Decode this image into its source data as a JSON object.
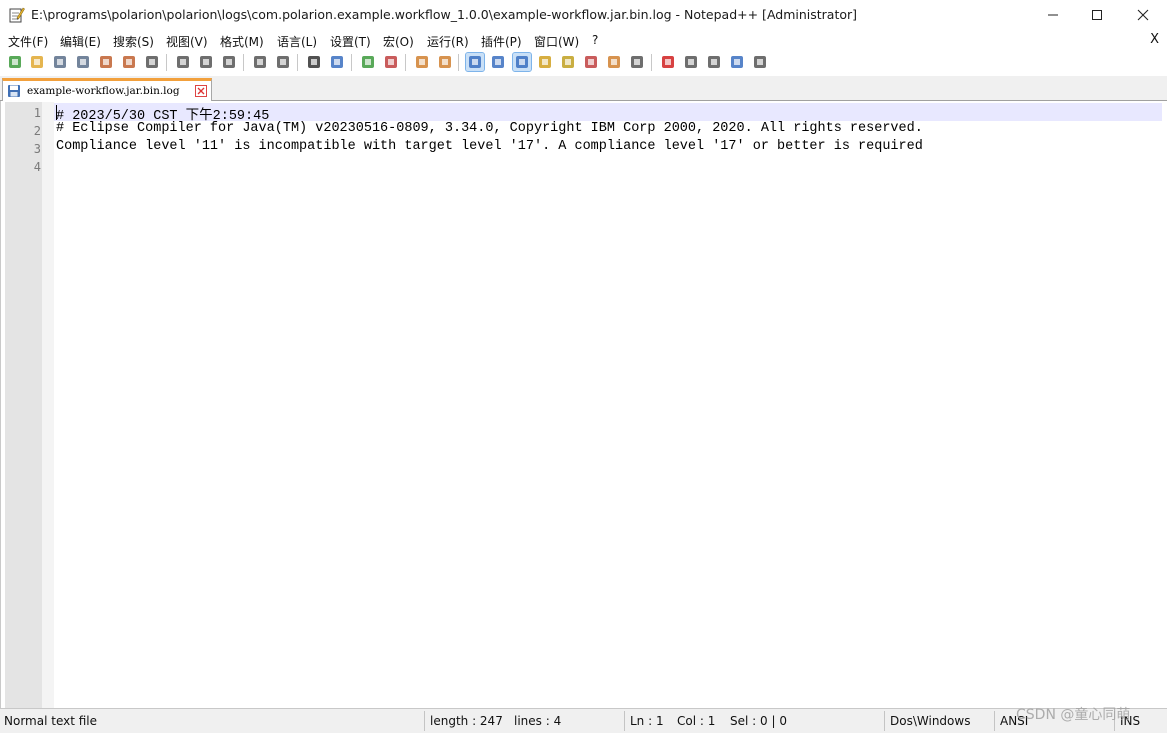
{
  "window": {
    "title": "E:\\programs\\polarion\\polarion\\logs\\com.polarion.example.workflow_1.0.0\\example-workflow.jar.bin.log - Notepad++ [Administrator]",
    "minimize_glyph": "—",
    "maximize_glyph": "☐",
    "close_glyph": "✕"
  },
  "menu": {
    "items": [
      "文件(F)",
      "编辑(E)",
      "搜索(S)",
      "视图(V)",
      "格式(M)",
      "语言(L)",
      "设置(T)",
      "宏(O)",
      "运行(R)",
      "插件(P)",
      "窗口(W)",
      "?"
    ],
    "close_doc": "X"
  },
  "toolbar": {
    "buttons": [
      {
        "icon": "new-file-icon",
        "color": "#3c9a3c"
      },
      {
        "icon": "open-file-icon",
        "color": "#e0a830"
      },
      {
        "icon": "save-icon",
        "color": "#5a6f8a"
      },
      {
        "icon": "save-all-icon",
        "color": "#5a6f8a"
      },
      {
        "icon": "close-icon",
        "color": "#c06030"
      },
      {
        "icon": "close-all-icon",
        "color": "#c06030"
      },
      {
        "icon": "print-icon",
        "color": "#555555"
      },
      {
        "icon": "cut-icon",
        "color": "#555555"
      },
      {
        "icon": "copy-icon",
        "color": "#555555"
      },
      {
        "icon": "paste-icon",
        "color": "#555555"
      },
      {
        "icon": "undo-icon",
        "color": "#555555"
      },
      {
        "icon": "redo-icon",
        "color": "#555555"
      },
      {
        "icon": "find-icon",
        "color": "#333333"
      },
      {
        "icon": "replace-icon",
        "color": "#3a6fc0"
      },
      {
        "icon": "zoom-in-icon",
        "color": "#3c9a3c"
      },
      {
        "icon": "zoom-out-icon",
        "color": "#c04040"
      },
      {
        "icon": "sync-vertical-icon",
        "color": "#d08030"
      },
      {
        "icon": "sync-horizontal-icon",
        "color": "#d08030"
      },
      {
        "icon": "word-wrap-icon",
        "color": "#3a6fc0"
      },
      {
        "icon": "show-all-chars-icon",
        "color": "#3a6fc0"
      },
      {
        "icon": "indent-guide-icon",
        "color": "#3a6fc0"
      },
      {
        "icon": "user-language-icon",
        "color": "#d0a020"
      },
      {
        "icon": "doc-map-icon",
        "color": "#c0a020"
      },
      {
        "icon": "function-list-icon",
        "color": "#c04040"
      },
      {
        "icon": "folder-as-workspace-icon",
        "color": "#d08030"
      },
      {
        "icon": "monitoring-icon",
        "color": "#555555"
      },
      {
        "icon": "record-macro-icon",
        "color": "#d02020"
      },
      {
        "icon": "stop-macro-icon",
        "color": "#555555"
      },
      {
        "icon": "play-macro-icon",
        "color": "#555555"
      },
      {
        "icon": "run-macro-multiple-icon",
        "color": "#3a6fc0"
      },
      {
        "icon": "save-macro-icon",
        "color": "#555555"
      }
    ]
  },
  "tab": {
    "label": "example-workflow.jar.bin.log"
  },
  "editor": {
    "line_numbers": [
      "1",
      "2",
      "3",
      "4"
    ],
    "lines": [
      "# 2023/5/30 CST 下午2:59:45",
      "# Eclipse Compiler for Java(TM) v20230516-0809, 3.34.0, Copyright IBM Corp 2000, 2020. All rights reserved.",
      "Compliance level '11' is incompatible with target level '17'. A compliance level '17' or better is required",
      ""
    ]
  },
  "status": {
    "file_type": "Normal text file",
    "length": "length : 247",
    "lines": "lines : 4",
    "ln": "Ln : 1",
    "col": "Col : 1",
    "sel": "Sel : 0 | 0",
    "eol": "Dos\\Windows",
    "encoding": "ANSI",
    "mode": "INS"
  },
  "watermark": "CSDN @童心同萌"
}
